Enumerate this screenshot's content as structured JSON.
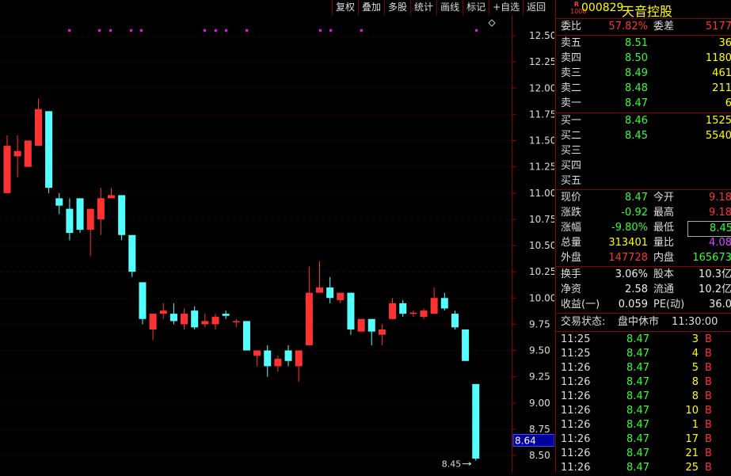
{
  "toolbar": {
    "items": [
      "复权",
      "叠加",
      "多股",
      "统计",
      "画线",
      "标记",
      "+自选",
      "返回"
    ]
  },
  "header": {
    "badge_top": "R",
    "badge_bottom": "1000",
    "code": "000829",
    "name": "天音控股"
  },
  "orderbook": {
    "weibi_label": "委比",
    "weibi_value": "57.82%",
    "weicha_label": "委差",
    "weicha_value": "5177",
    "asks": [
      {
        "label": "卖五",
        "price": "8.51",
        "vol": "36"
      },
      {
        "label": "卖四",
        "price": "8.50",
        "vol": "1180"
      },
      {
        "label": "卖三",
        "price": "8.49",
        "vol": "461"
      },
      {
        "label": "卖二",
        "price": "8.48",
        "vol": "211"
      },
      {
        "label": "卖一",
        "price": "8.47",
        "vol": "6"
      }
    ],
    "bids": [
      {
        "label": "买一",
        "price": "8.46",
        "vol": "1525"
      },
      {
        "label": "买二",
        "price": "8.45",
        "vol": "5540"
      },
      {
        "label": "买三",
        "price": "",
        "vol": ""
      },
      {
        "label": "买四",
        "price": "",
        "vol": ""
      },
      {
        "label": "买五",
        "price": "",
        "vol": ""
      }
    ]
  },
  "quote": [
    {
      "l1": "现价",
      "v1": "8.47",
      "c1": "green",
      "l2": "今开",
      "v2": "9.18",
      "c2": "red"
    },
    {
      "l1": "涨跌",
      "v1": "-0.92",
      "c1": "green",
      "l2": "最高",
      "v2": "9.18",
      "c2": "red"
    },
    {
      "l1": "涨幅",
      "v1": "-9.80%",
      "c1": "green",
      "l2": "最低",
      "v2": "8.45",
      "c2": "green"
    },
    {
      "l1": "总量",
      "v1": "313401",
      "c1": "yellow",
      "l2": "量比",
      "v2": "4.08",
      "c2": "purple"
    },
    {
      "l1": "外盘",
      "v1": "147728",
      "c1": "red",
      "l2": "内盘",
      "v2": "165673",
      "c2": "green"
    }
  ],
  "fundamentals": [
    {
      "l1": "换手",
      "v1": "3.06%",
      "l2": "股本",
      "v2": "10.3亿"
    },
    {
      "l1": "净资",
      "v1": "2.58",
      "l2": "流通",
      "v2": "10.2亿"
    },
    {
      "l1": "收益(一)",
      "v1": "0.059",
      "l2": "PE(动)",
      "v2": "36.0"
    }
  ],
  "status": {
    "label": "交易状态:",
    "value": "盘中休市",
    "time": "11:30:00"
  },
  "ticks": [
    {
      "time": "11:25",
      "price": "8.47",
      "vol": "3",
      "side": "B"
    },
    {
      "time": "11:25",
      "price": "8.47",
      "vol": "4",
      "side": "B"
    },
    {
      "time": "11:26",
      "price": "8.47",
      "vol": "5",
      "side": "B"
    },
    {
      "time": "11:26",
      "price": "8.47",
      "vol": "8",
      "side": "B"
    },
    {
      "time": "11:26",
      "price": "8.47",
      "vol": "8",
      "side": "B"
    },
    {
      "time": "11:26",
      "price": "8.47",
      "vol": "10",
      "side": "B"
    },
    {
      "time": "11:26",
      "price": "8.47",
      "vol": "1",
      "side": "B"
    },
    {
      "time": "11:26",
      "price": "8.47",
      "vol": "17",
      "side": "B"
    },
    {
      "time": "11:26",
      "price": "8.47",
      "vol": "21",
      "side": "B"
    },
    {
      "time": "11:26",
      "price": "8.47",
      "vol": "25",
      "side": "B"
    }
  ],
  "chart_data": {
    "type": "candlestick",
    "y_ticks": [
      "12.50",
      "12.25",
      "12.00",
      "11.75",
      "11.50",
      "11.25",
      "11.00",
      "10.75",
      "10.50",
      "10.25",
      "10.00",
      "9.75",
      "9.50",
      "9.25",
      "9.00",
      "8.75",
      "8.50"
    ],
    "ylim": [
      8.4,
      12.6
    ],
    "current_price_label": "8.64",
    "low_annotation": "8.45",
    "candles": [
      {
        "o": 11.0,
        "h": 11.55,
        "l": 11.0,
        "c": 11.45
      },
      {
        "o": 11.35,
        "h": 11.55,
        "l": 11.15,
        "c": 11.4
      },
      {
        "o": 11.25,
        "h": 11.45,
        "l": 11.25,
        "c": 11.5
      },
      {
        "o": 11.45,
        "h": 11.9,
        "l": 11.45,
        "c": 11.8
      },
      {
        "o": 11.78,
        "h": 11.78,
        "l": 11.0,
        "c": 11.05
      },
      {
        "o": 10.95,
        "h": 11.0,
        "l": 10.8,
        "c": 10.88
      },
      {
        "o": 10.85,
        "h": 10.95,
        "l": 10.55,
        "c": 10.62
      },
      {
        "o": 10.95,
        "h": 10.95,
        "l": 10.62,
        "c": 10.65
      },
      {
        "o": 10.65,
        "h": 10.85,
        "l": 10.4,
        "c": 10.85
      },
      {
        "o": 10.75,
        "h": 11.05,
        "l": 10.6,
        "c": 10.95
      },
      {
        "o": 10.95,
        "h": 11.05,
        "l": 10.95,
        "c": 10.98
      },
      {
        "o": 10.98,
        "h": 10.98,
        "l": 10.55,
        "c": 10.6
      },
      {
        "o": 10.6,
        "h": 10.6,
        "l": 10.2,
        "c": 10.25
      },
      {
        "o": 10.15,
        "h": 10.15,
        "l": 9.75,
        "c": 9.8
      },
      {
        "o": 9.7,
        "h": 9.85,
        "l": 9.6,
        "c": 9.85
      },
      {
        "o": 9.85,
        "h": 9.95,
        "l": 9.8,
        "c": 9.88
      },
      {
        "o": 9.85,
        "h": 9.95,
        "l": 9.75,
        "c": 9.78
      },
      {
        "o": 9.75,
        "h": 9.9,
        "l": 9.7,
        "c": 9.85
      },
      {
        "o": 9.88,
        "h": 9.92,
        "l": 9.7,
        "c": 9.72
      },
      {
        "o": 9.75,
        "h": 9.85,
        "l": 9.72,
        "c": 9.78
      },
      {
        "o": 9.75,
        "h": 9.85,
        "l": 9.7,
        "c": 9.82
      },
      {
        "o": 9.85,
        "h": 9.88,
        "l": 9.8,
        "c": 9.83
      },
      {
        "o": 9.78,
        "h": 9.8,
        "l": 9.72,
        "c": 9.78
      },
      {
        "o": 9.78,
        "h": 9.78,
        "l": 9.5,
        "c": 9.5
      },
      {
        "o": 9.45,
        "h": 9.5,
        "l": 9.35,
        "c": 9.5
      },
      {
        "o": 9.5,
        "h": 9.55,
        "l": 9.25,
        "c": 9.35
      },
      {
        "o": 9.35,
        "h": 9.45,
        "l": 9.3,
        "c": 9.42
      },
      {
        "o": 9.5,
        "h": 9.55,
        "l": 9.35,
        "c": 9.4
      },
      {
        "o": 9.35,
        "h": 9.5,
        "l": 9.2,
        "c": 9.5
      },
      {
        "o": 9.55,
        "h": 10.3,
        "l": 9.55,
        "c": 10.05
      },
      {
        "o": 10.05,
        "h": 10.35,
        "l": 10.05,
        "c": 10.1
      },
      {
        "o": 10.1,
        "h": 10.2,
        "l": 9.95,
        "c": 10.0
      },
      {
        "o": 9.98,
        "h": 10.05,
        "l": 9.95,
        "c": 10.05
      },
      {
        "o": 10.05,
        "h": 10.05,
        "l": 9.65,
        "c": 9.7
      },
      {
        "o": 9.68,
        "h": 9.8,
        "l": 9.68,
        "c": 9.8
      },
      {
        "o": 9.8,
        "h": 9.8,
        "l": 9.55,
        "c": 9.68
      },
      {
        "o": 9.65,
        "h": 9.75,
        "l": 9.55,
        "c": 9.7
      },
      {
        "o": 9.8,
        "h": 10.0,
        "l": 9.8,
        "c": 9.95
      },
      {
        "o": 9.95,
        "h": 9.98,
        "l": 9.82,
        "c": 9.85
      },
      {
        "o": 9.85,
        "h": 9.88,
        "l": 9.82,
        "c": 9.86
      },
      {
        "o": 9.82,
        "h": 9.9,
        "l": 9.8,
        "c": 9.88
      },
      {
        "o": 9.85,
        "h": 10.1,
        "l": 9.85,
        "c": 10.0
      },
      {
        "o": 10.0,
        "h": 10.05,
        "l": 9.88,
        "c": 9.9
      },
      {
        "o": 9.85,
        "h": 9.88,
        "l": 9.7,
        "c": 9.72
      },
      {
        "o": 9.7,
        "h": 9.7,
        "l": 9.4,
        "c": 9.4
      },
      {
        "o": 9.18,
        "h": 9.18,
        "l": 8.45,
        "c": 8.47
      }
    ],
    "marker_color": "#ff00ff"
  }
}
